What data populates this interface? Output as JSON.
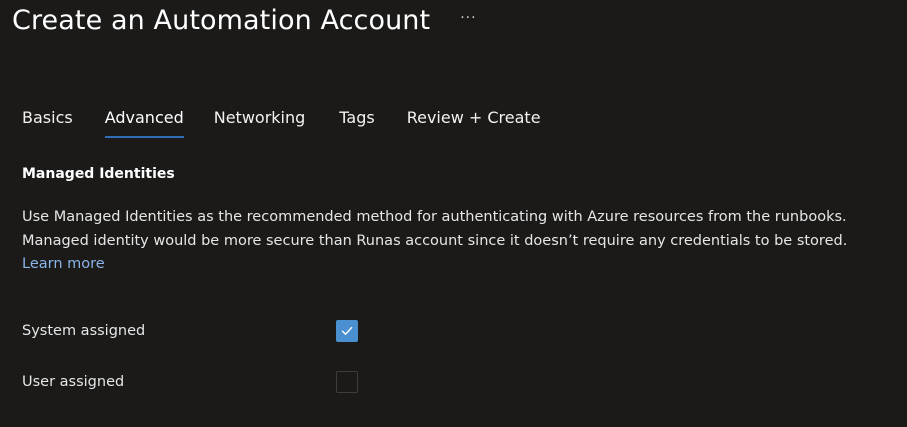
{
  "header": {
    "title": "Create an Automation Account",
    "more_label": "···"
  },
  "tabs": [
    {
      "label": "Basics",
      "active": false
    },
    {
      "label": "Advanced",
      "active": true
    },
    {
      "label": "Networking",
      "active": false
    },
    {
      "label": "Tags",
      "active": false
    },
    {
      "label": "Review + Create",
      "active": false
    }
  ],
  "managed_identities": {
    "heading": "Managed Identities",
    "description": "Use Managed Identities as the recommended method for authenticating with Azure resources from the runbooks. Managed identity would be more secure than Runas account since it doesn’t require any credentials to be stored.",
    "learn_more_label": "Learn more",
    "options": [
      {
        "label": "System assigned",
        "checked": true
      },
      {
        "label": "User assigned",
        "checked": false
      }
    ]
  },
  "colors": {
    "background": "#1b1a19",
    "accent": "#2f6fb5",
    "checkbox_checked": "#4a8fd0",
    "link": "#8ab4e8"
  },
  "icons": {
    "more": "ellipsis-icon",
    "check": "checkmark-icon"
  }
}
